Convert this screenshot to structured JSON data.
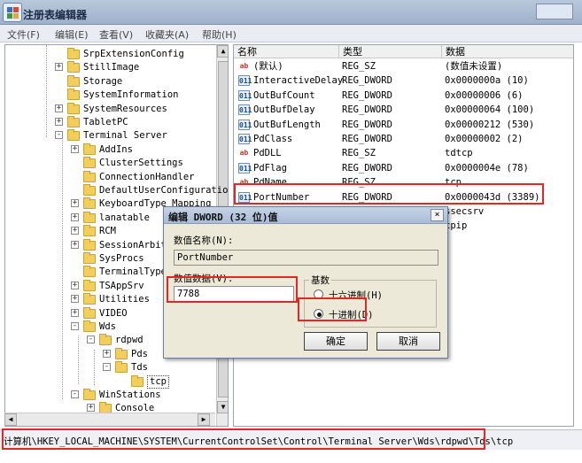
{
  "window": {
    "title": "注册表编辑器"
  },
  "menu": [
    "文件(F)",
    "编辑(E)",
    "查看(V)",
    "收藏夹(A)",
    "帮助(H)"
  ],
  "tree": {
    "items": [
      {
        "label": "SrpExtensionConfig",
        "depth": 1,
        "expander": "none"
      },
      {
        "label": "StillImage",
        "depth": 1,
        "expander": "+"
      },
      {
        "label": "Storage",
        "depth": 1,
        "expander": "none"
      },
      {
        "label": "SystemInformation",
        "depth": 1,
        "expander": "none"
      },
      {
        "label": "SystemResources",
        "depth": 1,
        "expander": "+"
      },
      {
        "label": "TabletPC",
        "depth": 1,
        "expander": "+"
      },
      {
        "label": "Terminal Server",
        "depth": 1,
        "expander": "-"
      },
      {
        "label": "AddIns",
        "depth": 2,
        "expander": "+"
      },
      {
        "label": "ClusterSettings",
        "depth": 2,
        "expander": "none"
      },
      {
        "label": "ConnectionHandler",
        "depth": 2,
        "expander": "none"
      },
      {
        "label": "DefaultUserConfiguration",
        "depth": 2,
        "expander": "none"
      },
      {
        "label": "KeyboardType Mapping",
        "depth": 2,
        "expander": "+"
      },
      {
        "label": "lanatable",
        "depth": 2,
        "expander": "+"
      },
      {
        "label": "RCM",
        "depth": 2,
        "expander": "+"
      },
      {
        "label": "SessionArbitrat",
        "depth": 2,
        "expander": "+"
      },
      {
        "label": "SysProcs",
        "depth": 2,
        "expander": "none"
      },
      {
        "label": "TerminalTypes",
        "depth": 2,
        "expander": "none"
      },
      {
        "label": "TSAppSrv",
        "depth": 2,
        "expander": "+"
      },
      {
        "label": "Utilities",
        "depth": 2,
        "expander": "+"
      },
      {
        "label": "VIDEO",
        "depth": 2,
        "expander": "+"
      },
      {
        "label": "Wds",
        "depth": 2,
        "expander": "-"
      },
      {
        "label": "rdpwd",
        "depth": 3,
        "expander": "-"
      },
      {
        "label": "Pds",
        "depth": 4,
        "expander": "+"
      },
      {
        "label": "Tds",
        "depth": 4,
        "expander": "-"
      },
      {
        "label": "tcp",
        "depth": 5,
        "expander": "none",
        "selected": true
      },
      {
        "label": "WinStations",
        "depth": 2,
        "expander": "-"
      },
      {
        "label": "Console",
        "depth": 3,
        "expander": "+"
      }
    ]
  },
  "list": {
    "columns": [
      "名称",
      "类型",
      "数据"
    ],
    "rows": [
      {
        "icon": "ab",
        "name": "(默认)",
        "type": "REG_SZ",
        "data": "(数值未设置)"
      },
      {
        "icon": "011",
        "name": "InteractiveDelay",
        "type": "REG_DWORD",
        "data": "0x0000000a (10)"
      },
      {
        "icon": "011",
        "name": "OutBufCount",
        "type": "REG_DWORD",
        "data": "0x00000006 (6)"
      },
      {
        "icon": "011",
        "name": "OutBufDelay",
        "type": "REG_DWORD",
        "data": "0x00000064 (100)"
      },
      {
        "icon": "011",
        "name": "OutBufLength",
        "type": "REG_DWORD",
        "data": "0x00000212 (530)"
      },
      {
        "icon": "011",
        "name": "PdClass",
        "type": "REG_DWORD",
        "data": "0x00000002 (2)"
      },
      {
        "icon": "ab",
        "name": "PdDLL",
        "type": "REG_SZ",
        "data": "tdtcp"
      },
      {
        "icon": "011",
        "name": "PdFlag",
        "type": "REG_DWORD",
        "data": "0x0000004e (78)"
      },
      {
        "icon": "ab",
        "name": "PdName",
        "type": "REG_SZ",
        "data": "tcp"
      },
      {
        "icon": "011",
        "name": "PortNumber",
        "type": "REG_DWORD",
        "data": "0x0000043d (3389)"
      },
      {
        "icon": "ab",
        "name": "",
        "type": "",
        "data": "ssecsrv"
      },
      {
        "icon": "ab",
        "name": "",
        "type": "",
        "data": "cpip"
      }
    ]
  },
  "status": {
    "path": "计算机\\HKEY_LOCAL_MACHINE\\SYSTEM\\CurrentControlSet\\Control\\Terminal Server\\Wds\\rdpwd\\Tds\\tcp"
  },
  "dialog": {
    "title": "编辑 DWORD (32 位)值",
    "name_label": "数值名称(N):",
    "name_value": "PortNumber",
    "data_label": "数值数据(V):",
    "data_value": "7788",
    "base_label": "基数",
    "hex_label": "十六进制(H)",
    "dec_label": "十进制(D)",
    "ok_label": "确定",
    "cancel_label": "取消",
    "close_glyph": "×"
  },
  "colors": {
    "highlight": "#e32626",
    "selection": "#316ac5"
  }
}
